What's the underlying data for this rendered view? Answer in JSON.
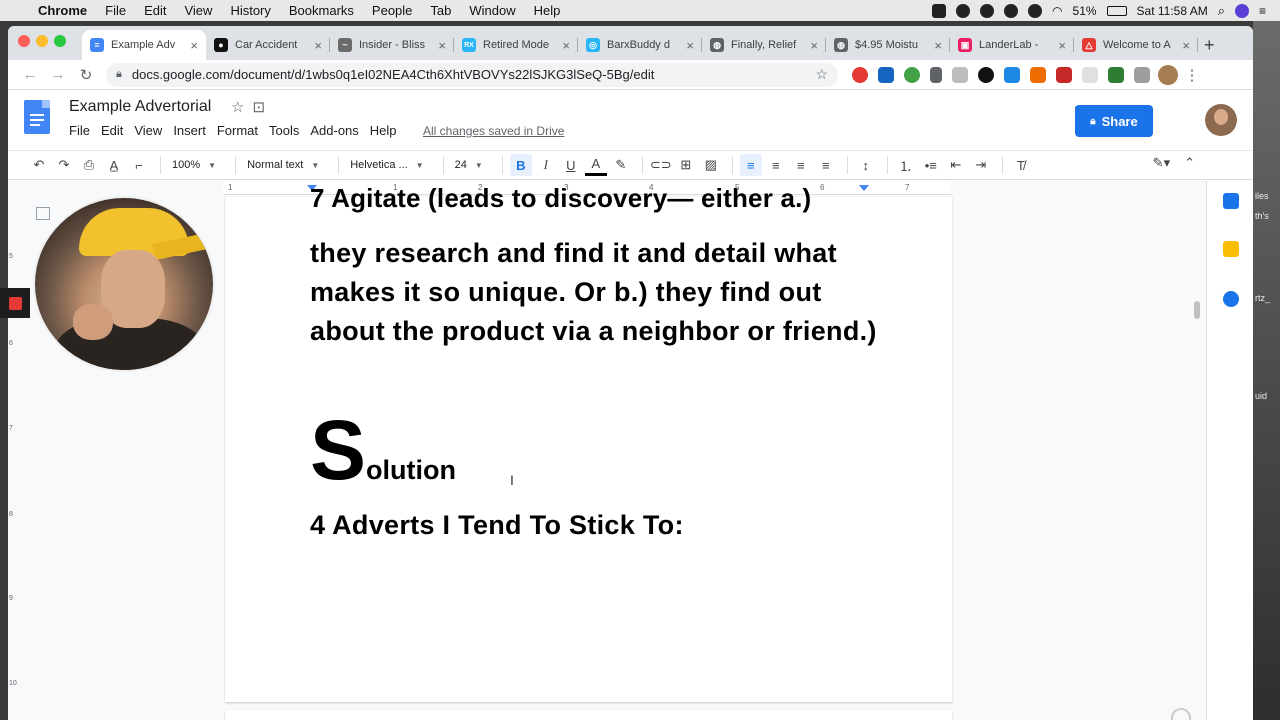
{
  "menubar": {
    "app": "Chrome",
    "items": [
      "File",
      "Edit",
      "View",
      "History",
      "Bookmarks",
      "People",
      "Tab",
      "Window",
      "Help"
    ],
    "battery": "51%",
    "clock": "Sat 11:58 AM"
  },
  "browser": {
    "tabs": [
      {
        "title": "Example Adv",
        "color": "#4285f4",
        "glyph": "≡"
      },
      {
        "title": "Car Accident",
        "color": "#111111",
        "glyph": "●"
      },
      {
        "title": "Insider - Bliss",
        "color": "#6b6b6b",
        "glyph": "~"
      },
      {
        "title": "Retired Mode",
        "color": "#29b6f6",
        "glyph": "RX"
      },
      {
        "title": "BarxBuddy d",
        "color": "#29b6f6",
        "glyph": "◎"
      },
      {
        "title": "Finally, Relief",
        "color": "#5f6368",
        "glyph": "◍"
      },
      {
        "title": "$4.95 Moistu",
        "color": "#5f6368",
        "glyph": "◍"
      },
      {
        "title": "LanderLab -",
        "color": "#e91e63",
        "glyph": "▣"
      },
      {
        "title": "Welcome to A",
        "color": "#e53935",
        "glyph": "△"
      }
    ],
    "url": "docs.google.com/document/d/1wbs0q1eI02NEA4Cth6XhtVBOVYs22lSJKG3lSeQ-5Bg/edit"
  },
  "docs": {
    "title": "Example Advertorial",
    "menu": [
      "File",
      "Edit",
      "View",
      "Insert",
      "Format",
      "Tools",
      "Add-ons",
      "Help"
    ],
    "saved_status": "All changes saved in Drive",
    "share_label": "Share",
    "zoom": "100%",
    "style": "Normal text",
    "font": "Helvetica ...",
    "font_size": "24"
  },
  "ruler": [
    "1",
    "1",
    "2",
    "3",
    "4",
    "5",
    "6",
    "7"
  ],
  "vruler": [
    "5",
    "6",
    "7",
    "8",
    "9",
    "10"
  ],
  "document": {
    "cutoff_line": "7 Agitate (leads to discovery— either a.)",
    "paragraph": "they research and find it and detail what makes it so unique. Or b.) they find out about the product via a neighbor or friend.)",
    "solution_initial": "S",
    "solution_rest": "olution",
    "adverts_heading": "4 Adverts I Tend To Stick To:"
  },
  "desktop_right_labels": [
    "iles",
    "th's",
    "rtz_",
    "uid"
  ]
}
